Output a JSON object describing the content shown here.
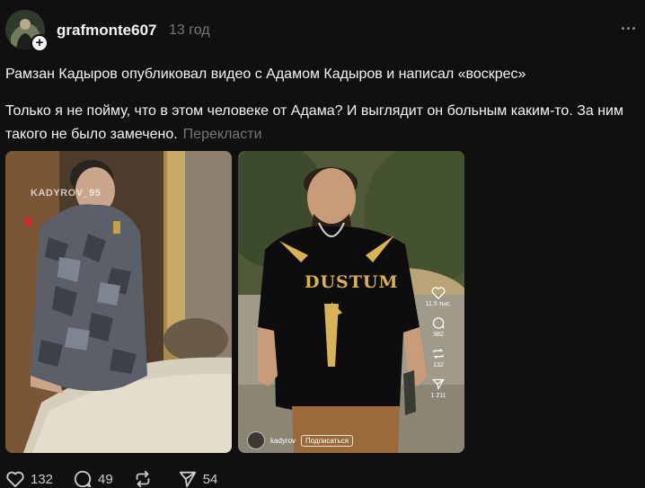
{
  "post": {
    "username": "grafmonte607",
    "time": "13 год",
    "follow_symbol": "+",
    "text_line1": "Рамзан Кадыров опубликовал видео с Адамом Кадыров и написал «воскрес»",
    "text_para2": "Только я не пойму, что в этом человеке от Адама? И выглядит он больным каким-то. За ним такого не было замечено.",
    "translate": "Перекласти"
  },
  "media": [
    {
      "watermark": "KADYROV_95"
    },
    {
      "shirt_text": "DUSTUM",
      "likes": "11,5 тыс.",
      "comments": "382",
      "reposts": "132",
      "shares": "1 211",
      "tt_user": "kadyrov",
      "tt_subscribe": "Подписаться"
    }
  ],
  "actions": {
    "likes": "132",
    "comments": "49",
    "reposts": "",
    "shares": "54"
  },
  "icons": {
    "avatar": "avatar-image",
    "more": "more-icon",
    "like": "heart-icon",
    "comment": "comment-icon",
    "repost": "repost-icon",
    "share": "send-icon"
  },
  "colors": {
    "background": "#101010",
    "text": "#f3f5f7",
    "muted": "#777777",
    "shirt_gold": "#d9b257"
  }
}
